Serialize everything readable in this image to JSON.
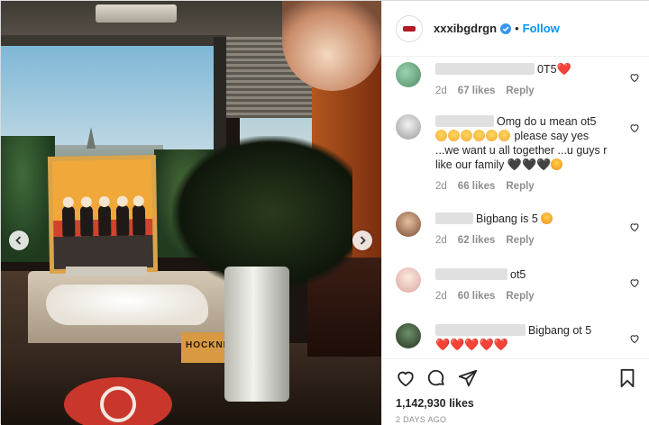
{
  "post": {
    "username": "xxxibgdrgn",
    "separator": "•",
    "follow_label": "Follow",
    "likes_total": "1,142,930 likes",
    "timestamp": "2 DAYS AGO",
    "painting_label": "HOCKNEY"
  },
  "comments": [
    {
      "text": "0T5",
      "suffix": "❤️",
      "age": "2d",
      "likes": "67 likes",
      "reply": "Reply"
    },
    {
      "text": "Omg do u mean ot5",
      "line2": "please say yes",
      "line3": "...we want u all together ...u guys r",
      "line4": "like our family",
      "suffix": "🖤🖤🖤",
      "age": "2d",
      "likes": "66 likes",
      "reply": "Reply"
    },
    {
      "text": "Bigbang is 5",
      "age": "2d",
      "likes": "62 likes",
      "reply": "Reply"
    },
    {
      "text": "ot5",
      "age": "2d",
      "likes": "60 likes",
      "reply": "Reply"
    },
    {
      "text": "Bigbang ot 5",
      "suffix": "❤️❤️❤️❤️❤️"
    }
  ],
  "colors": {
    "accent": "#0095f6",
    "heart": "#e0245e",
    "verified": "#3897f0"
  },
  "icons": {
    "carousel_prev": "chevron-left-icon",
    "carousel_next": "chevron-right-icon",
    "like": "heart-icon",
    "comment": "comment-icon",
    "share": "paper-plane-icon",
    "save": "bookmark-icon",
    "verified": "verified-badge-icon"
  }
}
